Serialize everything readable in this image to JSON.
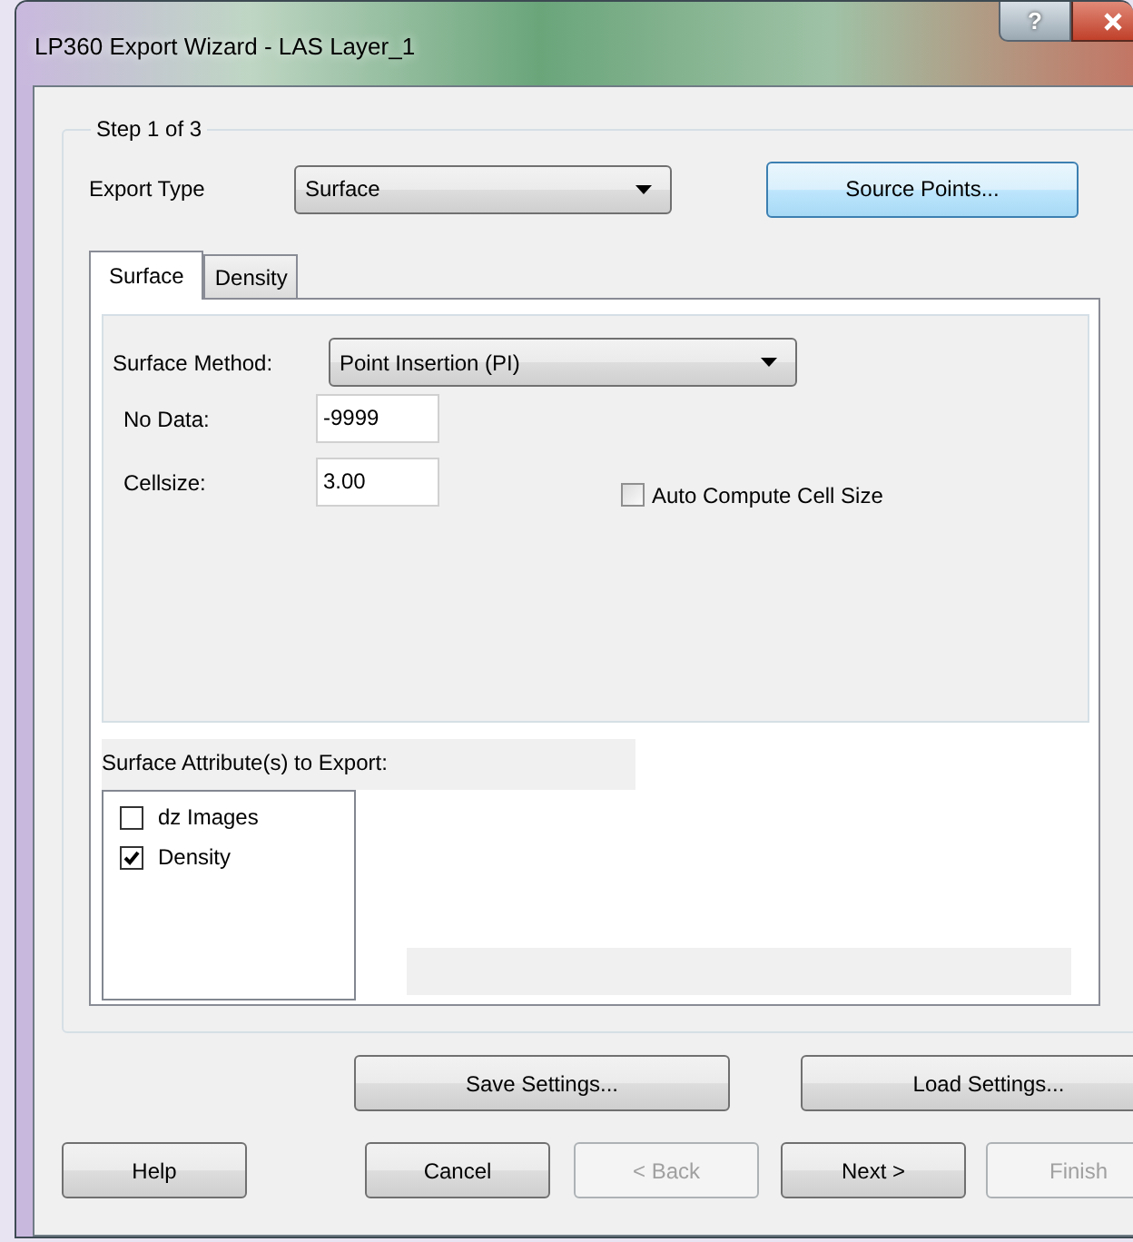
{
  "window": {
    "title": "LP360 Export Wizard - LAS Layer_1",
    "help_button": "?"
  },
  "step_group": {
    "title": "Step 1 of 3"
  },
  "export_type": {
    "label": "Export Type",
    "value": "Surface"
  },
  "source_points_button": "Source Points...",
  "tabs": [
    {
      "label": "Surface",
      "selected": true
    },
    {
      "label": "Density",
      "selected": false
    }
  ],
  "surface_method": {
    "label": "Surface Method:",
    "value": "Point Insertion (PI)"
  },
  "fields": [
    {
      "label": "No Data:",
      "value": "-9999"
    },
    {
      "label": "Cellsize:",
      "value": "3.00"
    }
  ],
  "auto_compute": {
    "label": "Auto Compute Cell Size",
    "checked": false
  },
  "attributes": {
    "label": "Surface Attribute(s) to Export:",
    "items": [
      {
        "label": "dz Images",
        "checked": false
      },
      {
        "label": "Density",
        "checked": true
      }
    ]
  },
  "settings_buttons": [
    {
      "label": "Save Settings...",
      "disabled": false
    },
    {
      "label": "Load Settings...",
      "disabled": false
    }
  ],
  "nav_buttons": [
    {
      "label": "Help",
      "disabled": false
    },
    {
      "label": "Cancel",
      "disabled": false
    },
    {
      "label": "< Back",
      "disabled": true
    },
    {
      "label": "Next >",
      "disabled": false
    },
    {
      "label": "Finish",
      "disabled": true
    }
  ]
}
